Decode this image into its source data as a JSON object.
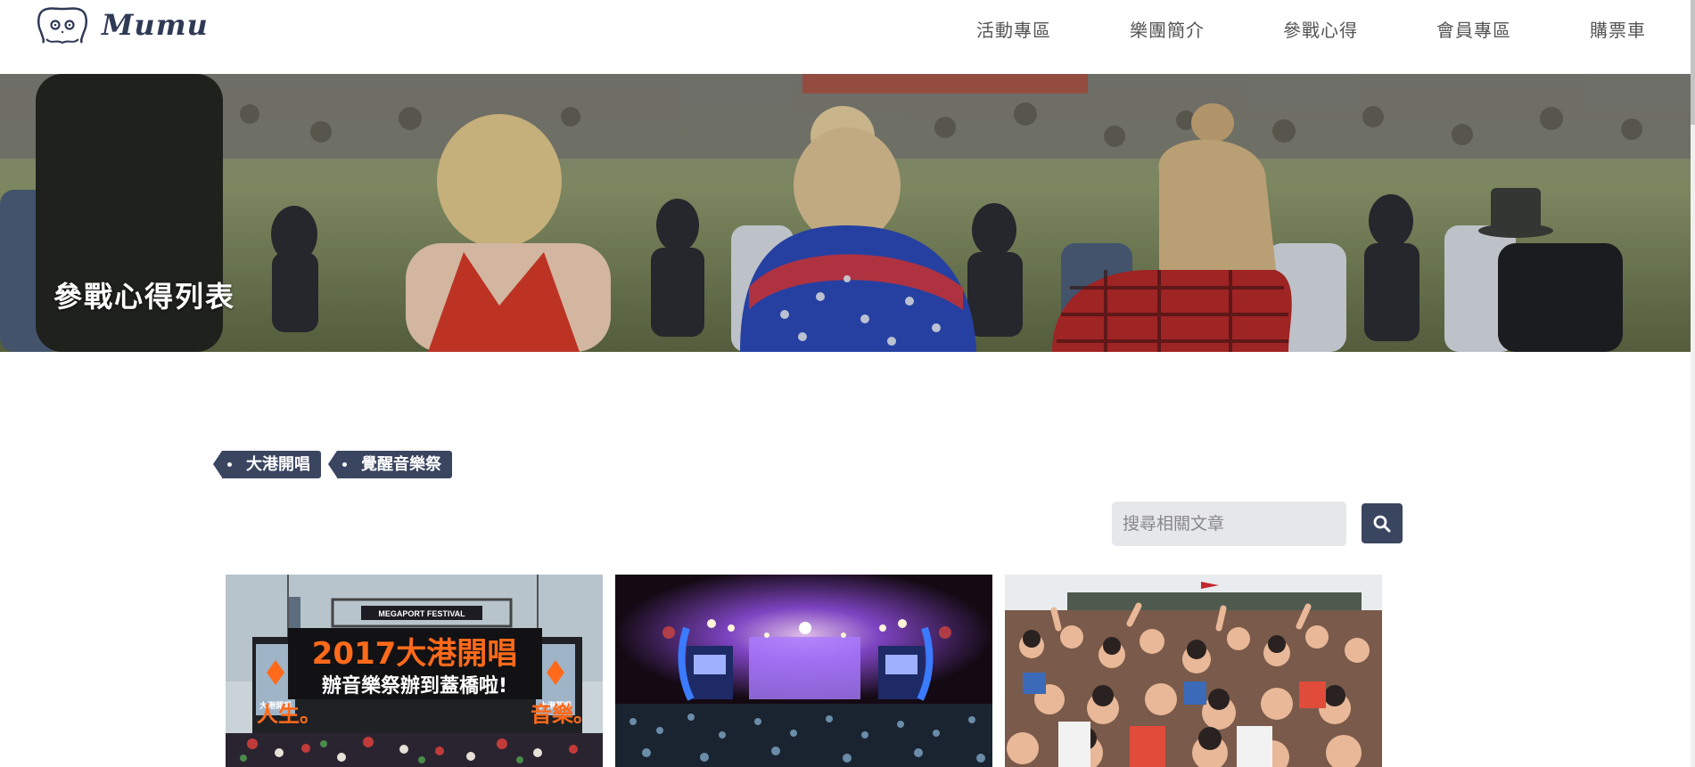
{
  "header": {
    "logo_text": "Mumu",
    "nav": [
      "活動專區",
      "樂團簡介",
      "參戰心得",
      "會員專區",
      "購票車"
    ]
  },
  "hero": {
    "title": "參戰心得列表"
  },
  "tags": [
    "大港開唱",
    "覺醒音樂祭"
  ],
  "search": {
    "placeholder": "搜尋相關文章",
    "value": "",
    "button_icon": "search-icon"
  },
  "cards": [
    {
      "image": "megaport-festival-stage",
      "banner_top": "MEGAPORT FESTIVAL",
      "headline": "2017大港開唱",
      "subline": "辦音樂祭辦到蓋橋啦!",
      "left_text": "人生。",
      "right_text": "音樂。",
      "side_label": "大港開唱"
    },
    {
      "image": "night-concert-stage"
    },
    {
      "image": "festival-crowd-cheering"
    }
  ],
  "colors": {
    "accent": "#3a4560",
    "search_bg": "#e6e7ea",
    "orange": "#ff6a1a"
  }
}
